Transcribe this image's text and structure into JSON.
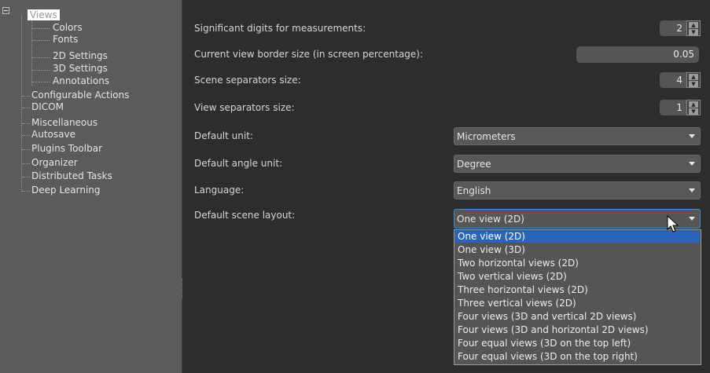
{
  "tree": {
    "items": [
      {
        "label": "Views",
        "selected": true
      },
      {
        "label": "Colors"
      },
      {
        "label": "Fonts"
      },
      {
        "label": "2D Settings"
      },
      {
        "label": "3D Settings"
      },
      {
        "label": "Annotations"
      },
      {
        "label": "Configurable Actions"
      },
      {
        "label": "DICOM"
      },
      {
        "label": "Miscellaneous"
      },
      {
        "label": "Autosave"
      },
      {
        "label": "Plugins Toolbar"
      },
      {
        "label": "Organizer"
      },
      {
        "label": "Distributed Tasks"
      },
      {
        "label": "Deep Learning"
      }
    ]
  },
  "settings": {
    "significant_digits": {
      "label": "Significant digits for measurements:",
      "value": "2"
    },
    "border_size": {
      "label": "Current view border size (in screen percentage):",
      "value": "0.05"
    },
    "scene_separators": {
      "label": "Scene separators size:",
      "value": "4"
    },
    "view_separators": {
      "label": "View separators size:",
      "value": "1"
    },
    "default_unit": {
      "label": "Default unit:",
      "value": "Micrometers"
    },
    "angle_unit": {
      "label": "Default angle unit:",
      "value": "Degree"
    },
    "language": {
      "label": "Language:",
      "value": "English"
    },
    "scene_layout": {
      "label": "Default scene layout:",
      "value": "One view (2D)",
      "options": [
        "One view (2D)",
        "One view (3D)",
        "Two horizontal views (2D)",
        "Two vertical views (2D)",
        "Three horizontal views (2D)",
        "Three vertical views (2D)",
        "Four views (3D and vertical 2D views)",
        "Four views (3D and horizontal 2D views)",
        "Four equal views (3D on the top left)",
        "Four equal views (3D on the top right)"
      ],
      "highlighted_index": 0
    }
  },
  "colors": {
    "tree_bg": "#5b5b5b",
    "panel_bg": "#2d2d2d",
    "selection": "#2a63bb",
    "focus_border": "#3d8bd4"
  }
}
